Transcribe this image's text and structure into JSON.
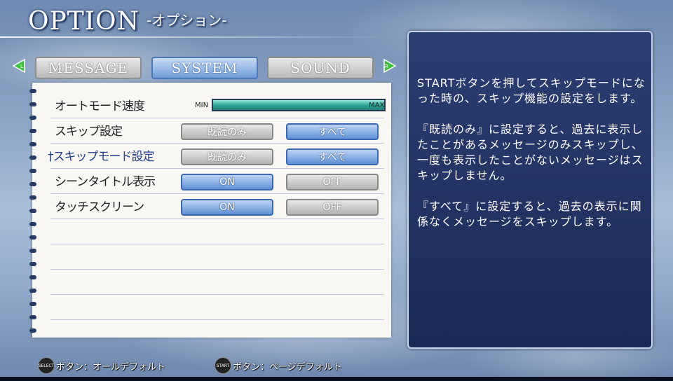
{
  "header": {
    "title": "OPTION",
    "subtitle": "-オプション-"
  },
  "tabs": [
    "MESSAGE",
    "SYSTEM",
    "SOUND"
  ],
  "active_tab": "SYSTEM",
  "settings": {
    "auto_speed": {
      "label": "オートモード速度",
      "min_label": "MIN",
      "max_label": "MAX",
      "value": 1.0
    },
    "skip": {
      "label": "スキップ設定",
      "options": [
        "既読のみ",
        "すべて"
      ],
      "selected": "すべて"
    },
    "skip_mode": {
      "label": "†スキップモード設定",
      "options": [
        "既読のみ",
        "すべて"
      ],
      "selected": "すべて"
    },
    "scene_title": {
      "label": "シーンタイトル表示",
      "options": [
        "ON",
        "OFF"
      ],
      "selected": "ON"
    },
    "touchscreen": {
      "label": "タッチスクリーン",
      "options": [
        "ON",
        "OFF"
      ],
      "selected": "ON"
    }
  },
  "help": {
    "text": "STARTボタンを押してスキップモードになった時の、スキップ機能の設定をします。\n\n『既読のみ』に設定すると、過去に表示したことがあるメッセージのみスキップし、一度も表示したことがないメッセージはスキップしません。\n\n『すべて』に設定すると、過去の表示に関係なくメッセージをスキップします。"
  },
  "footer": {
    "select_icon": "SELECT",
    "select_text": "ボタン：オールデフォルト",
    "start_icon": "START",
    "start_text": "ボタン：ページデフォルト"
  },
  "colors": {
    "accent_selected": "#5f90d6",
    "panel_bg": "#1c2a55",
    "slider_fill": "#2ea898"
  }
}
